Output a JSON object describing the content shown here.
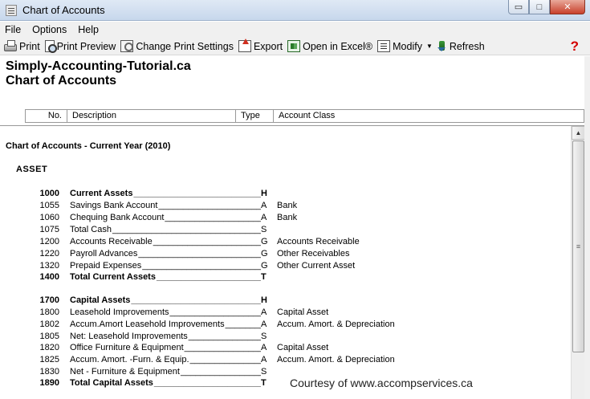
{
  "window": {
    "title": "Chart of Accounts",
    "minimize_glyph": "▭",
    "maximize_glyph": "□",
    "close_glyph": "✕"
  },
  "menu": [
    "File",
    "Options",
    "Help"
  ],
  "toolbar": {
    "print": "Print",
    "print_preview": "Print Preview",
    "change_print_settings": "Change Print Settings",
    "export": "Export",
    "open_in_excel": "Open in Excel®",
    "modify": "Modify",
    "refresh": "Refresh",
    "help_glyph": "?"
  },
  "report": {
    "company": "Simply-Accounting-Tutorial.ca",
    "title": "Chart of Accounts",
    "columns": {
      "no": "No.",
      "description": "Description",
      "type": "Type",
      "account_class": "Account Class"
    },
    "section_title": "Chart of Accounts - Current Year (2010)",
    "group_title": "ASSET",
    "rows": [
      {
        "no": "1000",
        "desc": "Current Assets",
        "type": "H",
        "cls": "",
        "bold": true
      },
      {
        "no": "1055",
        "desc": "Savings Bank Account",
        "type": "A",
        "cls": "Bank",
        "bold": false
      },
      {
        "no": "1060",
        "desc": "Chequing Bank Account",
        "type": "A",
        "cls": "Bank",
        "bold": false
      },
      {
        "no": "1075",
        "desc": "Total Cash",
        "type": "S",
        "cls": "",
        "bold": false
      },
      {
        "no": "1200",
        "desc": "Accounts Receivable",
        "type": "G",
        "cls": "Accounts Receivable",
        "bold": false
      },
      {
        "no": "1220",
        "desc": "Payroll Advances",
        "type": "G",
        "cls": "Other Receivables",
        "bold": false
      },
      {
        "no": "1320",
        "desc": "Prepaid Expenses",
        "type": "G",
        "cls": "Other Current Asset",
        "bold": false
      },
      {
        "no": "1400",
        "desc": "Total Current Assets",
        "type": "T",
        "cls": "",
        "bold": true
      },
      {
        "no": "1700",
        "desc": "Capital Assets",
        "type": "H",
        "cls": "",
        "bold": true
      },
      {
        "no": "1800",
        "desc": "Leasehold Improvements",
        "type": "A",
        "cls": "Capital Asset",
        "bold": false
      },
      {
        "no": "1802",
        "desc": "Accum.Amort Leasehold Improvements",
        "type": "A",
        "cls": "Accum. Amort. & Depreciation",
        "bold": false
      },
      {
        "no": "1805",
        "desc": "Net: Leasehold Improvements",
        "type": "S",
        "cls": "",
        "bold": false
      },
      {
        "no": "1820",
        "desc": "Office Furniture & Equipment",
        "type": "A",
        "cls": "Capital Asset",
        "bold": false
      },
      {
        "no": "1825",
        "desc": "Accum. Amort. -Furn. & Equip.",
        "type": "A",
        "cls": "Accum. Amort. & Depreciation",
        "bold": false
      },
      {
        "no": "1830",
        "desc": "Net - Furniture & Equipment",
        "type": "S",
        "cls": "",
        "bold": false
      },
      {
        "no": "1890",
        "desc": "Total Capital Assets",
        "type": "T",
        "cls": "",
        "bold": true
      }
    ]
  },
  "courtesy": "Courtesy of www.accompservices.ca"
}
